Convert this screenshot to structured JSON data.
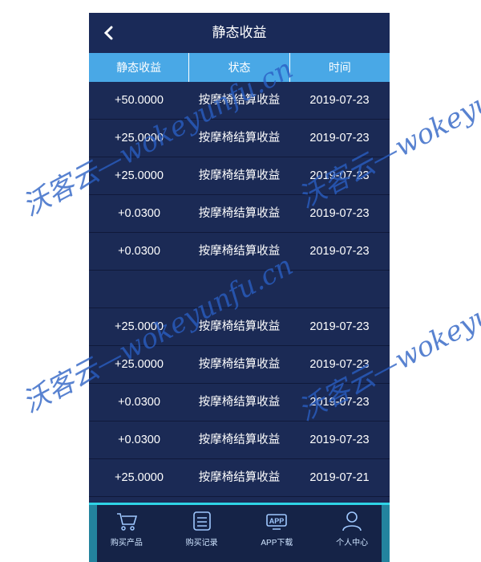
{
  "header": {
    "title": "静态收益",
    "back_icon": "chevron-left-icon"
  },
  "table": {
    "columns": [
      "静态收益",
      "状态",
      "时间"
    ],
    "rows": [
      [
        "+50.0000",
        "按摩椅结算收益",
        "2019-07-23"
      ],
      [
        "+25.0000",
        "按摩椅结算收益",
        "2019-07-23"
      ],
      [
        "+25.0000",
        "按摩椅结算收益",
        "2019-07-23"
      ],
      [
        "+0.0300",
        "按摩椅结算收益",
        "2019-07-23"
      ],
      [
        "+0.0300",
        "按摩椅结算收益",
        "2019-07-23"
      ],
      [
        "",
        "",
        ""
      ],
      [
        "+25.0000",
        "按摩椅结算收益",
        "2019-07-23"
      ],
      [
        "+25.0000",
        "按摩椅结算收益",
        "2019-07-23"
      ],
      [
        "+0.0300",
        "按摩椅结算收益",
        "2019-07-23"
      ],
      [
        "+0.0300",
        "按摩椅结算收益",
        "2019-07-23"
      ],
      [
        "+25.0000",
        "按摩椅结算收益",
        "2019-07-21"
      ]
    ]
  },
  "bottom_nav": {
    "items": [
      {
        "label": "购买产品",
        "icon": "cart-icon"
      },
      {
        "label": "购买记录",
        "icon": "list-icon"
      },
      {
        "label": "APP下载",
        "icon": "app-icon"
      },
      {
        "label": "个人中心",
        "icon": "user-icon"
      }
    ]
  },
  "watermark": {
    "text": "沃客云—wokeyunfu.cn"
  },
  "colors": {
    "background": "#1b2a55",
    "table_header": "#49a8e6",
    "nav_accent": "#2fd3e6",
    "watermark": "#2a5fc4"
  }
}
